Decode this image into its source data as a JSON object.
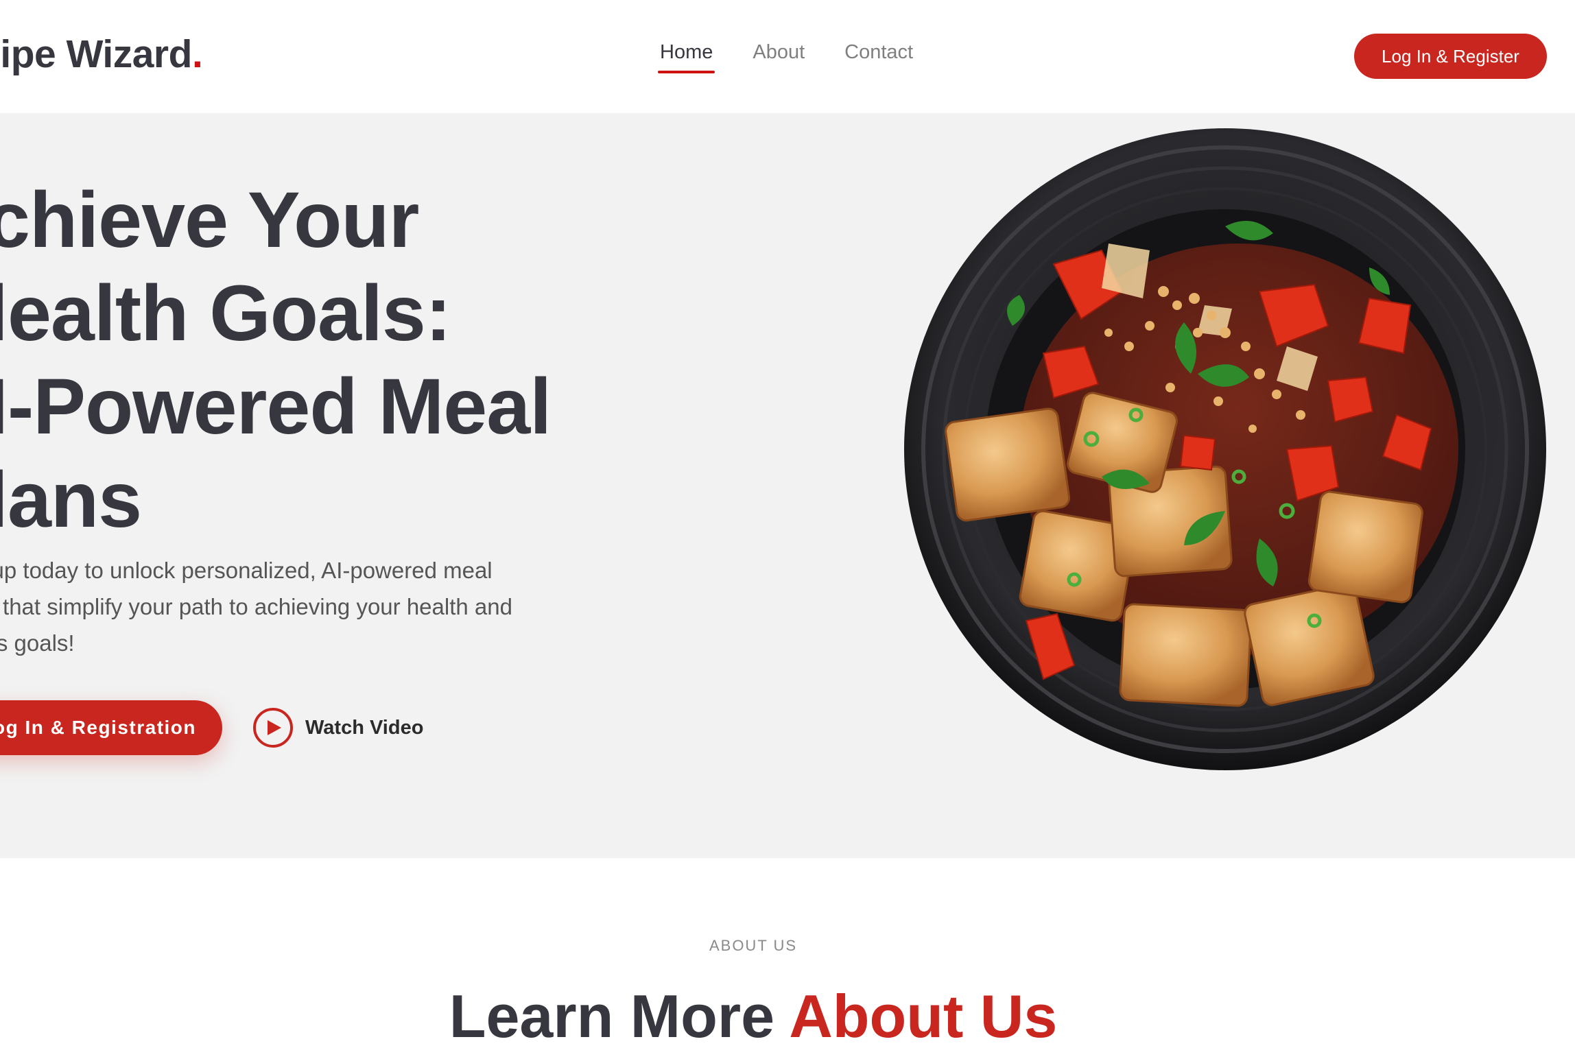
{
  "brand": {
    "name": "ecipe Wizard",
    "dot": "."
  },
  "nav": {
    "items": [
      {
        "label": "Home",
        "active": true
      },
      {
        "label": "About",
        "active": false
      },
      {
        "label": "Contact",
        "active": false
      }
    ]
  },
  "header": {
    "cta_label": "Log In & Register"
  },
  "hero": {
    "title_lines": [
      "chieve Your",
      "lealth Goals:",
      "I-Powered Meal",
      "lans"
    ],
    "description_lines": [
      "n up today to unlock personalized, AI-powered meal",
      "ns that simplify your path to achieving your health and",
      "ess goals!"
    ],
    "primary_button": "og In & Registration",
    "video_label": "Watch Video",
    "image_alt": "Tofu stir-fry with tomatoes, peanuts and herbs on a black plate"
  },
  "about": {
    "eyebrow": "ABOUT US",
    "title_part1": "Learn More ",
    "title_accent": "About Us"
  },
  "colors": {
    "accent": "#c8261f",
    "text_dark": "#37373f",
    "text_muted": "#7f7f7f",
    "hero_bg": "#f2f2f2"
  },
  "icons": {
    "play": "play-circle-icon"
  }
}
